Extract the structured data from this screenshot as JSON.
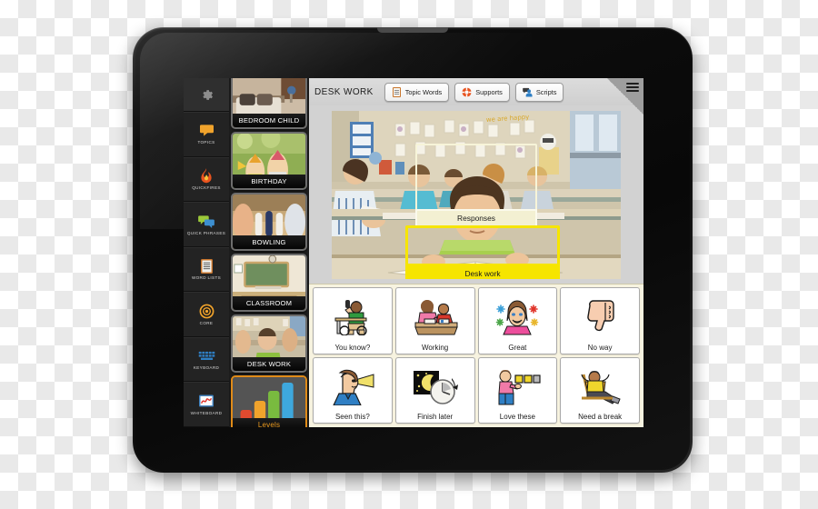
{
  "device": {
    "type": "tablet",
    "power_icon": "power-icon",
    "camera_icon": "camera-icon",
    "led_indicator_color": "#f0c53a"
  },
  "app": {
    "rail": {
      "settings_icon": "gear-icon",
      "items": [
        {
          "label": "TOPICS",
          "icon": "speech-bubble-icon"
        },
        {
          "label": "QUICKFIRES",
          "icon": "flame-icon"
        },
        {
          "label": "QUICK PHRASES",
          "icon": "double-speech-bubble-icon"
        },
        {
          "label": "WORD LISTS",
          "icon": "list-document-icon"
        },
        {
          "label": "CORE",
          "icon": "target-circle-icon"
        },
        {
          "label": "KEYBOARD",
          "icon": "keyboard-icon"
        },
        {
          "label": "WHITEBOARD",
          "icon": "whiteboard-scribble-icon"
        }
      ]
    },
    "thumbnails": [
      {
        "label": "BEDROOM CHILD",
        "selected": false
      },
      {
        "label": "BIRTHDAY",
        "selected": false
      },
      {
        "label": "BOWLING",
        "selected": false
      },
      {
        "label": "CLASSROOM",
        "selected": false
      },
      {
        "label": "DESK WORK",
        "selected": false
      },
      {
        "label": "Levels",
        "selected": true
      }
    ],
    "toolbar": {
      "title": "DESK WORK",
      "buttons": [
        {
          "label": "Topic Words",
          "icon": "notepad-icon"
        },
        {
          "label": "Supports",
          "icon": "lifebuoy-icon"
        },
        {
          "label": "Scripts",
          "icon": "person-speech-icon"
        }
      ],
      "menu_icon": "hamburger-menu-icon"
    },
    "scene": {
      "description": "classroom-photo",
      "overlays": [
        {
          "label": "Responses",
          "style": "cream"
        },
        {
          "label": "Desk work",
          "style": "yellow"
        }
      ]
    },
    "symbols": [
      {
        "label": "You know?",
        "icon": "student-raising-hand-icon"
      },
      {
        "label": "Working",
        "icon": "teacher-and-student-icon"
      },
      {
        "label": "Great",
        "icon": "smiling-woman-sparkles-icon"
      },
      {
        "label": "No way",
        "icon": "thumbs-down-icon"
      },
      {
        "label": "Seen this?",
        "icon": "person-looking-icon"
      },
      {
        "label": "Finish later",
        "icon": "moon-clock-icon"
      },
      {
        "label": "Love these",
        "icon": "person-choosing-squares-icon"
      },
      {
        "label": "Need a break",
        "icon": "person-relaxing-chair-icon"
      }
    ],
    "colors": {
      "accent_orange": "#eb9a1f",
      "highlight_yellow": "#f6e500",
      "panel_background": "#d2d2d2",
      "grid_background": "#f7f3e0",
      "rail_background": "#232323"
    }
  }
}
